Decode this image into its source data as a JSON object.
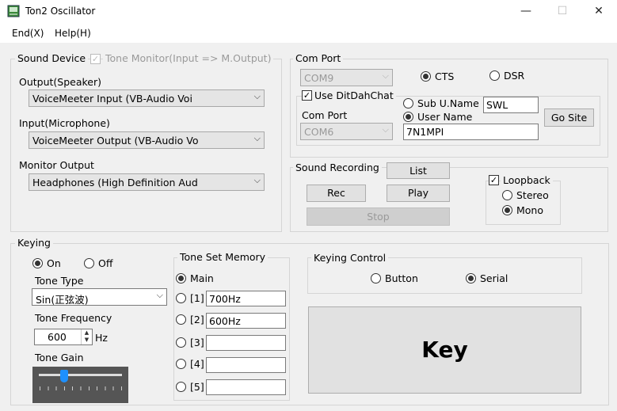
{
  "window": {
    "title": "Ton2 Oscillator",
    "minimize": "—",
    "maximize": "☐",
    "close": "✕"
  },
  "menu": {
    "items": [
      {
        "label": "End(X)"
      },
      {
        "label": "Help(H)"
      }
    ]
  },
  "sound_device": {
    "legend": "Sound Device",
    "tone_monitor_label": "Tone Monitor(Input => M.Output)",
    "tone_monitor_checked": true,
    "output_label": "Output(Speaker)",
    "output_value": "VoiceMeeter Input (VB-Audio Voi",
    "input_label": "Input(Microphone)",
    "input_value": "VoiceMeeter Output (VB-Audio Vo",
    "monitor_label": "Monitor Output",
    "monitor_value": "Headphones (High Definition Aud"
  },
  "com_port": {
    "legend": "Com Port",
    "port_value": "COM9",
    "cts_label": "CTS",
    "dsr_label": "DSR",
    "selected": "CTS",
    "ditdahchat_label": "Use DitDahChat",
    "ditdahchat_checked": true,
    "sub_uname_label": "Sub U.Name",
    "sub_uname_value": "SWL",
    "user_name_label": "User Name",
    "user_name_value": "7N1MPI",
    "name_selected": "User Name",
    "inner_com_label": "Com Port",
    "inner_com_value": "COM6",
    "go_site_label": "Go Site"
  },
  "sound_recording": {
    "legend": "Sound Recording",
    "list_label": "List",
    "rec_label": "Rec",
    "play_label": "Play",
    "stop_label": "Stop",
    "loopback_label": "Loopback",
    "loopback_checked": true,
    "stereo_label": "Stereo",
    "mono_label": "Mono",
    "selected": "Mono"
  },
  "keying": {
    "legend": "Keying",
    "on_label": "On",
    "off_label": "Off",
    "selected": "On",
    "tone_type_label": "Tone Type",
    "tone_type_value": "Sin(正弦波)",
    "tone_freq_label": "Tone Frequency",
    "tone_freq_value": "600",
    "tone_freq_unit": "Hz",
    "tone_gain_label": "Tone Gain",
    "tone_gain_level": 0.3
  },
  "tone_set_memory": {
    "legend": "Tone Set Memory",
    "main_label": "Main",
    "selected": "Main",
    "slots": [
      {
        "label": "[1]",
        "value": "700Hz"
      },
      {
        "label": "[2]",
        "value": "600Hz"
      },
      {
        "label": "[3]",
        "value": ""
      },
      {
        "label": "[4]",
        "value": ""
      },
      {
        "label": "[5]",
        "value": ""
      }
    ]
  },
  "keying_control": {
    "legend": "Keying Control",
    "button_label": "Button",
    "serial_label": "Serial",
    "selected": "Serial",
    "key_label": "Key"
  }
}
